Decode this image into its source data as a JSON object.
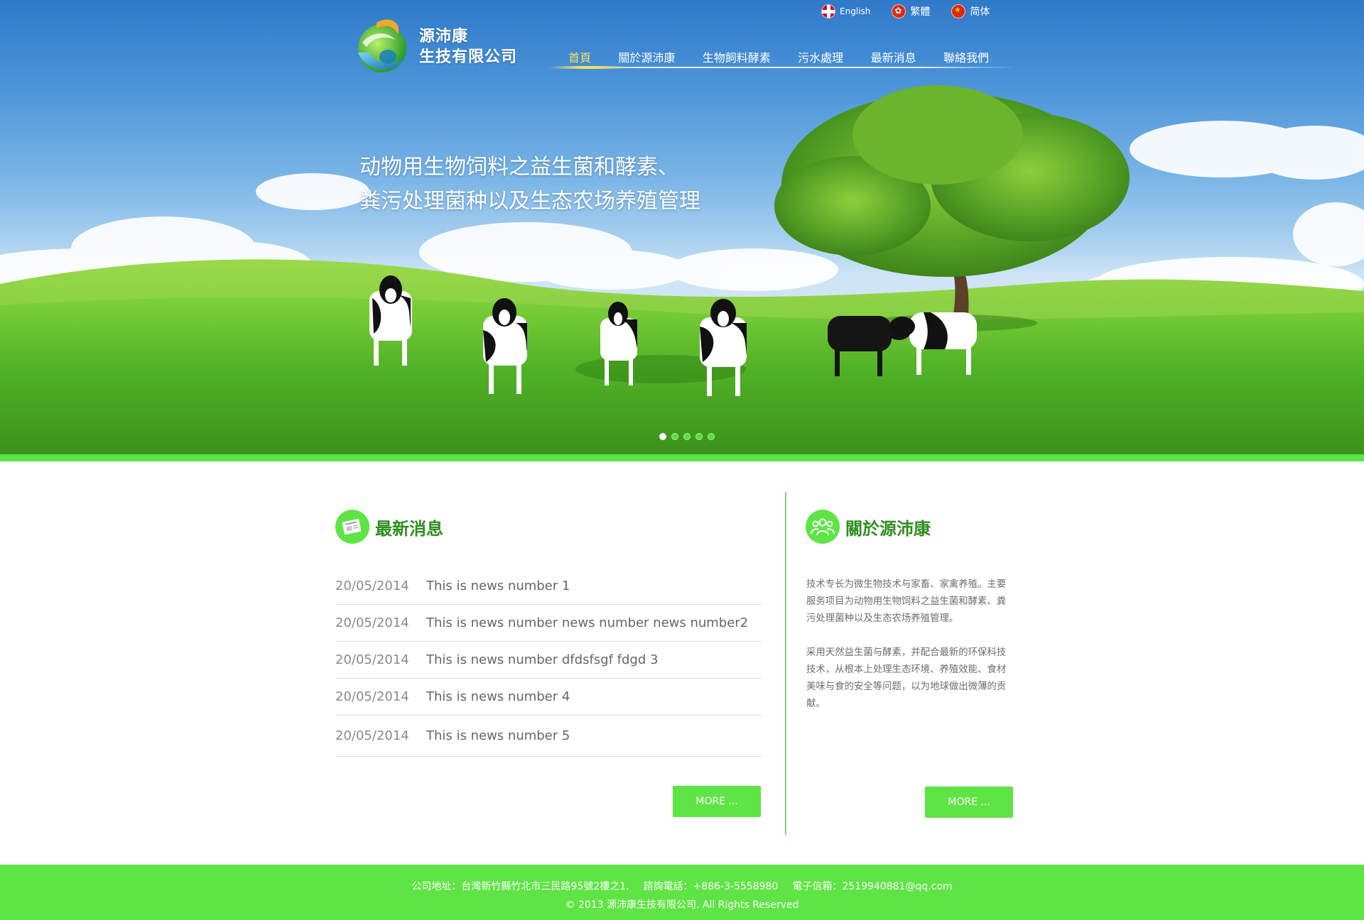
{
  "languages": [
    {
      "label": "English",
      "icon": "uk-flag-icon"
    },
    {
      "label": "繁體",
      "icon": "hk-flag-icon"
    },
    {
      "label": "简体",
      "icon": "cn-flag-icon"
    }
  ],
  "brand": {
    "line1": "源沛康",
    "line2": "生技有限公司",
    "logo_icon": "swirl-logo-icon"
  },
  "nav": {
    "items": [
      "首頁",
      "關於源沛康",
      "生物飼料酵素",
      "污水處理",
      "最新消息",
      "聯絡我們"
    ],
    "active_index": 0
  },
  "hero": {
    "line1": "动物用生物饲料之益生菌和酵素、",
    "line2": "粪污处理菌种以及生态农场养殖管理",
    "slide_count": 5,
    "active_slide": 1
  },
  "news": {
    "title": "最新消息",
    "icon": "newspaper-icon",
    "items": [
      {
        "date": "20/05/2014",
        "title": "This is news number 1"
      },
      {
        "date": "20/05/2014",
        "title": "This is news number news number  news number2"
      },
      {
        "date": "20/05/2014",
        "title": "This is news number dfdsfsgf fdgd 3"
      },
      {
        "date": "20/05/2014",
        "title": "This is news number 4"
      },
      {
        "date": "20/05/2014",
        "title": "This is news number 5"
      }
    ],
    "more": "MORE ..."
  },
  "about": {
    "title": "關於源沛康",
    "icon": "people-icon",
    "para1": "技术专长为微生物技术与家畜、家禽养殖。主要服务项目为动物用生物饲料之益生菌和酵素、粪污处理菌种以及生态农场养殖管理。",
    "para2": "采用天然益生菌与酵素，并配合最新的环保科技技术，从根本上处理生态环境、养殖效能、食材美味与食的安全等问题，以为地球做出微薄的贡献。",
    "more": "MORE ..."
  },
  "footer": {
    "address": "公司地址：台灣新竹縣竹北市三民路95號2樓之1.",
    "phone": "諮詢電話：+886-3-5558980",
    "email": "電子信箱：2519940881@qq.com",
    "copyright": "© 2013 源沛康生技有限公司. All Rights Reserved"
  },
  "colors": {
    "accent_green": "#5fe445",
    "title_green": "#2e8d1e",
    "nav_active": "#f6e35a"
  }
}
